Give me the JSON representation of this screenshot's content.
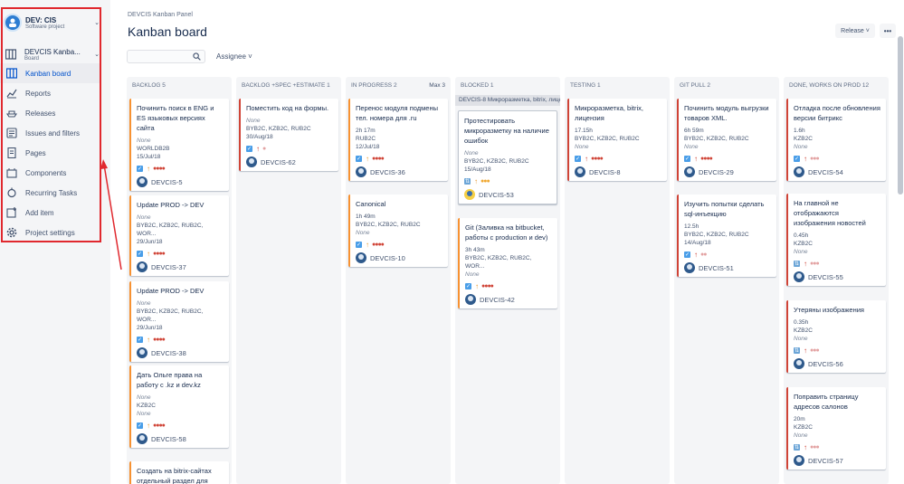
{
  "sidebar": {
    "project_name": "DEV: CIS",
    "project_type": "Software project",
    "board_name": "DEVCIS Kanba...",
    "board_type": "Board",
    "items": [
      {
        "label": "Kanban board"
      },
      {
        "label": "Reports"
      },
      {
        "label": "Releases"
      },
      {
        "label": "Issues and filters"
      },
      {
        "label": "Pages"
      },
      {
        "label": "Components"
      },
      {
        "label": "Recurring Tasks"
      },
      {
        "label": "Add item"
      },
      {
        "label": "Project settings"
      }
    ]
  },
  "header": {
    "breadcrumb": "DEVCIS Kanban Panel",
    "title": "Kanban board",
    "release_label": "Release ˅",
    "more_label": "•••"
  },
  "toolbar": {
    "assignee_label": "Assignee ˅"
  },
  "columns": [
    {
      "name": "BACKLOG 5",
      "max": ""
    },
    {
      "name": "BACKLOG +SPEC +ESTIMATE 1",
      "max": ""
    },
    {
      "name": "IN PROGRESS 2",
      "max": "Max 3"
    },
    {
      "name": "BLOCKED 1",
      "max": ""
    },
    {
      "name": "TESTING 1",
      "max": ""
    },
    {
      "name": "GIT PULL 2",
      "max": ""
    },
    {
      "name": "DONE, WORKS ON PROD 12",
      "max": ""
    }
  ],
  "blocked_swimlane": "DEVCIS-8 Микроразметка, bitrix, лиценз",
  "cards": {
    "c1": {
      "title": "Починить поиск в ENG и ES языковых версиях сайта",
      "m1": "None",
      "m2": "WORLDB2B",
      "m3": "15/Jul/18",
      "key": "DEVCIS-5"
    },
    "c2": {
      "title": "Update PROD -> DEV",
      "m1": "None",
      "m2": "BYB2C, KZB2C, RUB2C, WOR...",
      "m3": "29/Jun/18",
      "key": "DEVCIS-37"
    },
    "c3": {
      "title": "Update PROD -> DEV",
      "m1": "None",
      "m2": "BYB2C, KZB2C, RUB2C, WOR...",
      "m3": "29/Jun/18",
      "key": "DEVCIS-38"
    },
    "c4": {
      "title": "Дать Ольге права на работу с .kz и dev.kz",
      "m1": "None",
      "m2": "KZB2C",
      "m3": "None",
      "key": "DEVCIS-58"
    },
    "c5": {
      "title": "Создать на bitrix-сайтах отдельный раздел для"
    },
    "c6": {
      "title": "Поместить код на формы.",
      "m1": "None",
      "m2": "BYB2C, KZB2C, RUB2C",
      "m3": "30/Aug/18",
      "key": "DEVCIS-62"
    },
    "c7": {
      "title": "Перенос модуля подмены тел. номера для .ru",
      "m1": "2h 17m",
      "m2": "RUB2C",
      "m3": "12/Jul/18",
      "key": "DEVCIS-36"
    },
    "c8": {
      "title": "Canonical",
      "m1": "1h 49m",
      "m2": "BYB2C, KZB2C, RUB2C",
      "m3": "None",
      "key": "DEVCIS-10"
    },
    "c9": {
      "title": "Протестировать микроразметку на наличие ошибок",
      "m1": "None",
      "m2": "BYB2C, KZB2C, RUB2C",
      "m3": "15/Aug/18",
      "key": "DEVCIS-53"
    },
    "c10": {
      "title": "Git (Заливка на bitbucket, работы с production и dev)",
      "m1": "3h 43m",
      "m2": "BYB2C, KZB2C, RUB2C, WOR...",
      "m3": "None",
      "key": "DEVCIS-42"
    },
    "c11": {
      "title": "Микроразметка, bitrix, лицензия",
      "m1": "17.15h",
      "m2": "BYB2C, KZB2C, RUB2C",
      "m3": "None",
      "key": "DEVCIS-8"
    },
    "c12": {
      "title": "Починить модуль выгрузки товаров XML.",
      "m1": "6h 59m",
      "m2": "BYB2C, KZB2C, RUB2C",
      "m3": "None",
      "key": "DEVCIS-29"
    },
    "c13": {
      "title": "Изучить попытки сделать sql-инъекцию",
      "m1": "12.5h",
      "m2": "BYB2C, KZB2C, RUB2C",
      "m3": "14/Aug/18",
      "key": "DEVCIS-51"
    },
    "c14": {
      "title": "Отладка после обновления версии битрикс",
      "m1": "1.6h",
      "m2": "KZB2C",
      "m3": "None",
      "key": "DEVCIS-54"
    },
    "c15": {
      "title": "На главной не отображаются изображения новостей",
      "m1": "0.45h",
      "m2": "KZB2C",
      "m3": "None",
      "key": "DEVCIS-55"
    },
    "c16": {
      "title": "Утеряны изображения",
      "m1": "0.35h",
      "m2": "KZB2C",
      "m3": "None",
      "key": "DEVCIS-56"
    },
    "c17": {
      "title": "Поправить страницу адресов салонов",
      "m1": "20m",
      "m2": "KZB2C",
      "m3": "None",
      "key": "DEVCIS-57"
    }
  },
  "colors": {
    "annotation": "#e0282e",
    "priority_high": "#d04437",
    "priority_medium": "#f79232",
    "link_blue": "#0052cc"
  }
}
